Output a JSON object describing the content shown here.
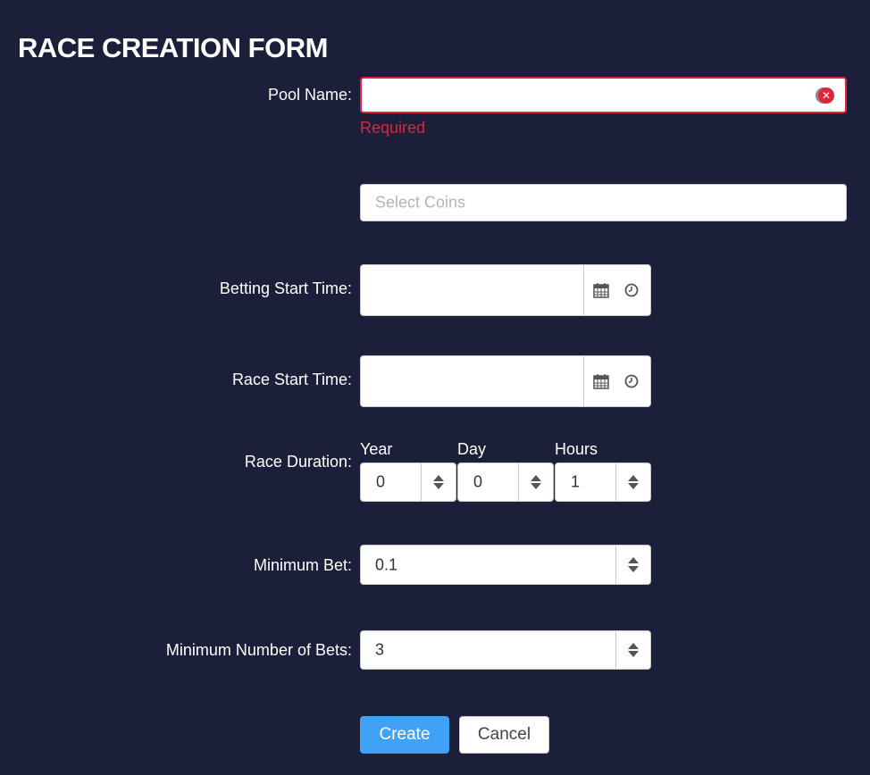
{
  "form": {
    "title": "RACE CREATION FORM",
    "pool_name": {
      "label": "Pool Name",
      "value": "",
      "error": "Required"
    },
    "coins": {
      "placeholder": "Select Coins"
    },
    "betting_start": {
      "label": "Betting Start Time",
      "value": ""
    },
    "race_start": {
      "label": "Race Start Time",
      "value": ""
    },
    "race_duration": {
      "label": "Race Duration",
      "year_label": "Year",
      "year_value": "0",
      "day_label": "Day",
      "day_value": "0",
      "hours_label": "Hours",
      "hours_value": "1"
    },
    "min_bet": {
      "label": "Minimum Bet",
      "value": "0.1"
    },
    "min_bets_count": {
      "label": "Minimum Number of Bets",
      "value": "3"
    },
    "create_label": "Create",
    "cancel_label": "Cancel"
  },
  "colors": {
    "background": "#1c1f3a",
    "error": "#e0223a",
    "primary": "#3fa2f7"
  }
}
